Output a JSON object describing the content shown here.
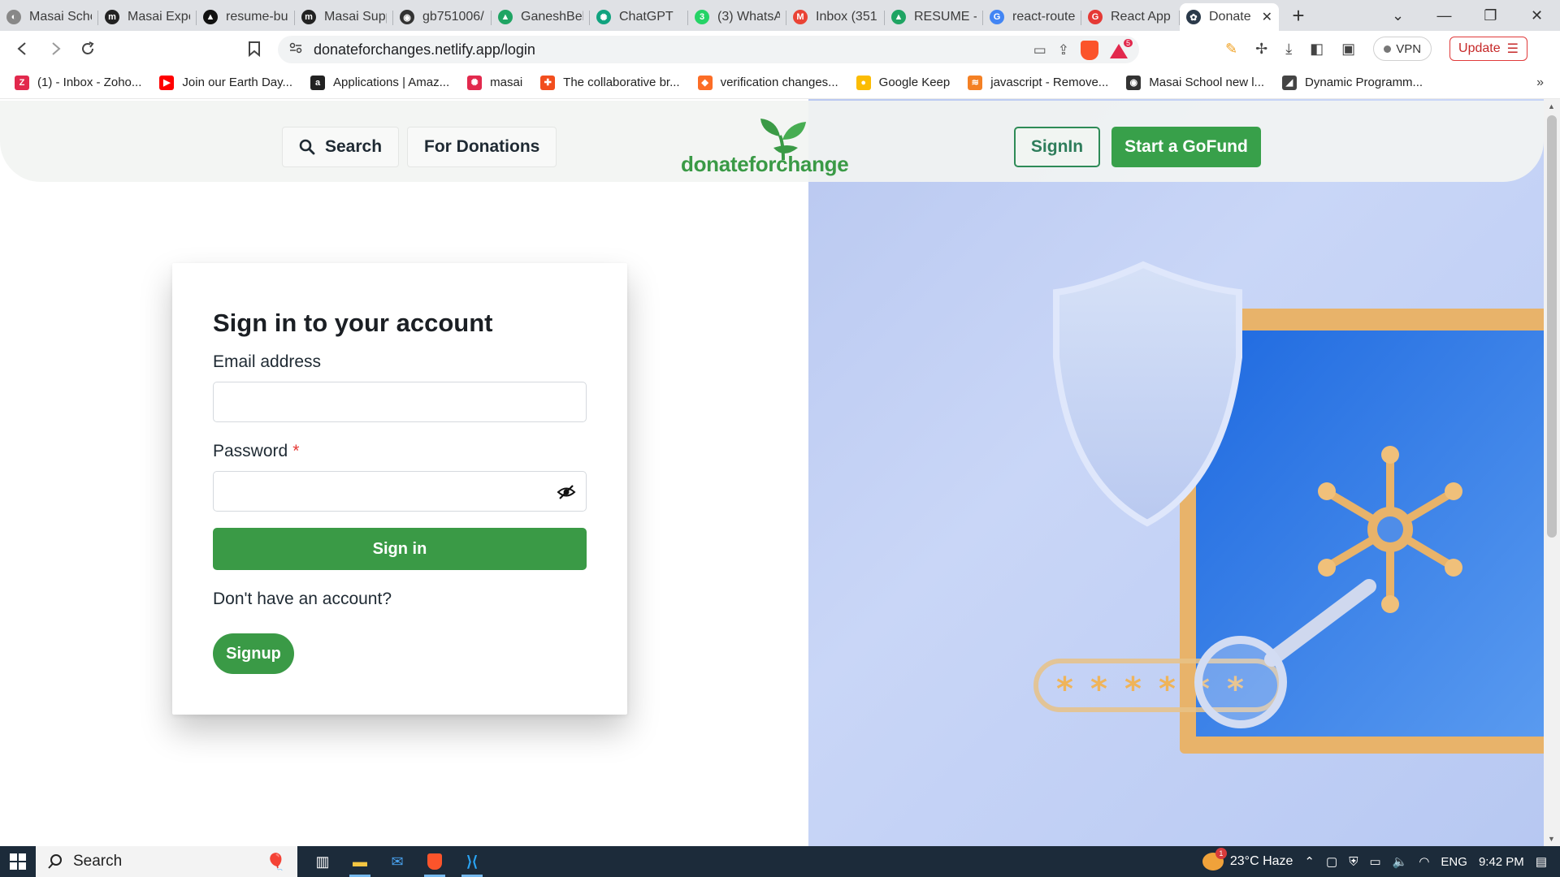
{
  "browser": {
    "tabs": [
      {
        "label": "Masai Scho",
        "color": "#888888",
        "glyph": "◐"
      },
      {
        "label": "Masai Expe",
        "color": "#222222",
        "glyph": "m"
      },
      {
        "label": "resume-bu",
        "color": "#111111",
        "glyph": "▲"
      },
      {
        "label": "Masai Supp",
        "color": "#222222",
        "glyph": "m"
      },
      {
        "label": "gb751006/",
        "color": "#333333",
        "glyph": "◉"
      },
      {
        "label": "GaneshBeh",
        "color": "#1fa463",
        "glyph": "▲"
      },
      {
        "label": "ChatGPT",
        "color": "#10a37f",
        "glyph": "✺"
      },
      {
        "label": "(3) WhatsA",
        "color": "#25d366",
        "glyph": "3"
      },
      {
        "label": "Inbox (351",
        "color": "#ea4335",
        "glyph": "M"
      },
      {
        "label": "RESUME - (",
        "color": "#1fa463",
        "glyph": "▲"
      },
      {
        "label": "react-route",
        "color": "#4285f4",
        "glyph": "G"
      },
      {
        "label": "React App",
        "color": "#e53935",
        "glyph": "G"
      }
    ],
    "active_tab": {
      "label": "Donate",
      "color": "#3a9a46",
      "glyph": "✿"
    },
    "new_tab": "+",
    "url": "donateforchanges.netlify.app/login",
    "vpn_label": "VPN",
    "update_label": "Update",
    "rewards_badge": "5",
    "bookmarks": [
      {
        "label": "(1) - Inbox - Zoho...",
        "color": "#e2294d",
        "glyph": "Z"
      },
      {
        "label": "Join our Earth Day...",
        "color": "#ff0000",
        "glyph": "▶"
      },
      {
        "label": "Applications | Amaz...",
        "color": "#222222",
        "glyph": "a"
      },
      {
        "label": "masai",
        "color": "#e2294d",
        "glyph": "✺"
      },
      {
        "label": "The collaborative br...",
        "color": "#f24e1e",
        "glyph": "✚"
      },
      {
        "label": "verification changes...",
        "color": "#fc6d26",
        "glyph": "◆"
      },
      {
        "label": "Google Keep",
        "color": "#fbbc04",
        "glyph": "●"
      },
      {
        "label": "javascript - Remove...",
        "color": "#f48024",
        "glyph": "≋"
      },
      {
        "label": "Masai School new l...",
        "color": "#333333",
        "glyph": "◉"
      },
      {
        "label": "Dynamic Programm...",
        "color": "#444444",
        "glyph": "◢"
      }
    ]
  },
  "navbar": {
    "search_label": "Search",
    "donations_label": "For Donations",
    "logo_text": "donateforchange",
    "signin_label": "SignIn",
    "gofund_label": "Start a GoFund"
  },
  "login": {
    "title": "Sign in to your account",
    "email_label": "Email address",
    "email_value": "",
    "password_label": "Password",
    "password_required": "*",
    "password_value": "",
    "submit_label": "Sign in",
    "no_account_text": "Don't have an account?",
    "signup_label": "Signup"
  },
  "taskbar": {
    "search_label": "Search",
    "weather": "23°C  Haze",
    "weather_badge": "1",
    "language": "ENG",
    "time": "9:42 PM"
  },
  "colors": {
    "brand_green": "#3a9a46",
    "signin_outline": "#2e8b57",
    "panel_blue": "#c4d2f5"
  }
}
